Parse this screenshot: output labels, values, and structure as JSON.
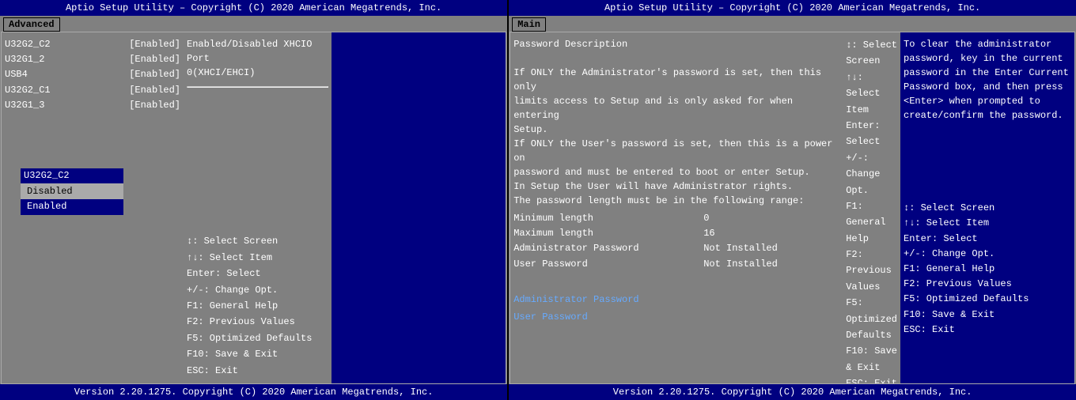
{
  "left_screen": {
    "title": "Aptio Setup Utility – Copyright (C) 2020 American Megatrends, Inc.",
    "tab": "Advanced",
    "items": [
      {
        "name": "U32G2_C2",
        "value": "[Enabled]"
      },
      {
        "name": "U32G1_2",
        "value": "[Enabled]"
      },
      {
        "name": "USB4",
        "value": "[Enabled]"
      },
      {
        "name": "U32G2_C1",
        "value": "[Enabled]"
      },
      {
        "name": "U32G1_3",
        "value": "[Enabled]"
      }
    ],
    "dropdown": {
      "title": "U32G2_C2",
      "options": [
        {
          "label": "Disabled",
          "selected": false
        },
        {
          "label": "Enabled",
          "selected": true
        }
      ]
    },
    "help_text": "Enabled/Disabled XHCIO Port 0(XHCI/EHCI)",
    "keys": [
      "↕: Select Screen",
      "↑↓: Select Item",
      "Enter: Select",
      "+/-: Change Opt.",
      "F1: General Help",
      "F2: Previous Values",
      "F5: Optimized Defaults",
      "F10: Save & Exit",
      "ESC: Exit"
    ],
    "footer": "Version 2.20.1275. Copyright (C) 2020 American Megatrends, Inc."
  },
  "right_screen": {
    "title": "Aptio Setup Utility – Copyright (C) 2020 American Megatrends, Inc.",
    "tab": "Main",
    "password_description": [
      "Password Description",
      "",
      "If ONLY the Administrator's password is set, then this only",
      "limits access to Setup and is only asked for when entering",
      "Setup.",
      "If ONLY the User's password is set, then this is a power on",
      "password and must be entered to boot or enter Setup.",
      "In Setup the User will have Administrator rights.",
      "The password length must be in the following range:"
    ],
    "password_table": [
      {
        "label": "Minimum length",
        "value": "0"
      },
      {
        "label": "Maximum length",
        "value": "16"
      },
      {
        "label": "Administrator Password",
        "value": "Not Installed"
      },
      {
        "label": "User Password",
        "value": "Not Installed"
      }
    ],
    "password_links": [
      "Administrator Password",
      "User Password"
    ],
    "right_help": "To clear the administrator password, key in the current password in the Enter Current Password box, and then press <Enter> when prompted to create/confirm the password.",
    "keys": [
      "↕: Select Screen",
      "↑↓: Select Item",
      "Enter: Select",
      "+/-: Change Opt.",
      "F1: General Help",
      "F2: Previous Values",
      "F5: Optimized Defaults",
      "F10: Save & Exit",
      "ESC: Exit"
    ],
    "footer": "Version 2.20.1275. Copyright (C) 2020 American Megatrends, Inc."
  }
}
